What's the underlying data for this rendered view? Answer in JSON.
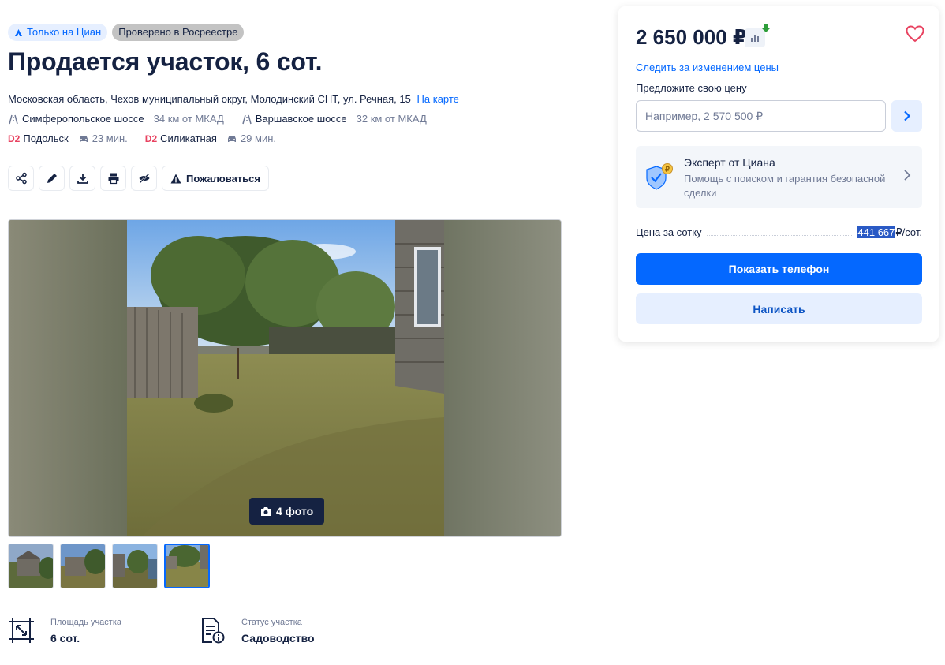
{
  "badges": {
    "only_cian": "Только на Циан",
    "rosreestr": "Проверено в Росреестре"
  },
  "listing": {
    "title": "Продается участок, 6 сот.",
    "address": "Московская область, Чехов муниципальный округ, Молодинский СНТ, ул. Речная, 15",
    "map_link": "На карте"
  },
  "highways": [
    {
      "name": "Симферопольское шоссе",
      "distance": "34 км от МКАД"
    },
    {
      "name": "Варшавское шоссе",
      "distance": "32 км от МКАД"
    }
  ],
  "stations": [
    {
      "line": "D2",
      "name": "Подольск",
      "time": "23 мин."
    },
    {
      "line": "D2",
      "name": "Силикатная",
      "time": "29 мин."
    }
  ],
  "actions": {
    "icons": [
      "share-icon",
      "edit-icon",
      "download-icon",
      "print-icon",
      "hide-icon"
    ],
    "complain_label": "Пожаловаться"
  },
  "gallery": {
    "photo_count_label": "4 фото",
    "thumbnails": 4,
    "active_thumbnail": 4
  },
  "facts": [
    {
      "label": "Площадь участка",
      "value": "6 сот.",
      "icon": "area-icon"
    },
    {
      "label": "Статус участка",
      "value": "Садоводство",
      "icon": "document-info-icon"
    }
  ],
  "sidebar": {
    "price": "2 650 000 ₽",
    "follow_price": "Следить за изменением цены",
    "offer_label": "Предложите свою цену",
    "offer_placeholder": "Например, 2 570 500 ₽",
    "expert_title": "Эксперт от Циана",
    "expert_subtitle": "Помощь с поиском и гарантия безопасной сделки",
    "price_per_sotka_label": "Цена за сотку",
    "price_per_sotka_value": "441 667",
    "price_per_sotka_unit": "₽/сот.",
    "show_phone": "Показать телефон",
    "write": "Написать"
  },
  "colors": {
    "accent": "#0468ff",
    "text": "#152242",
    "secondary_text": "#707a95",
    "d2_line": "#e84260",
    "price_drop": "#2e9e3a",
    "favorite": "#e84260"
  }
}
